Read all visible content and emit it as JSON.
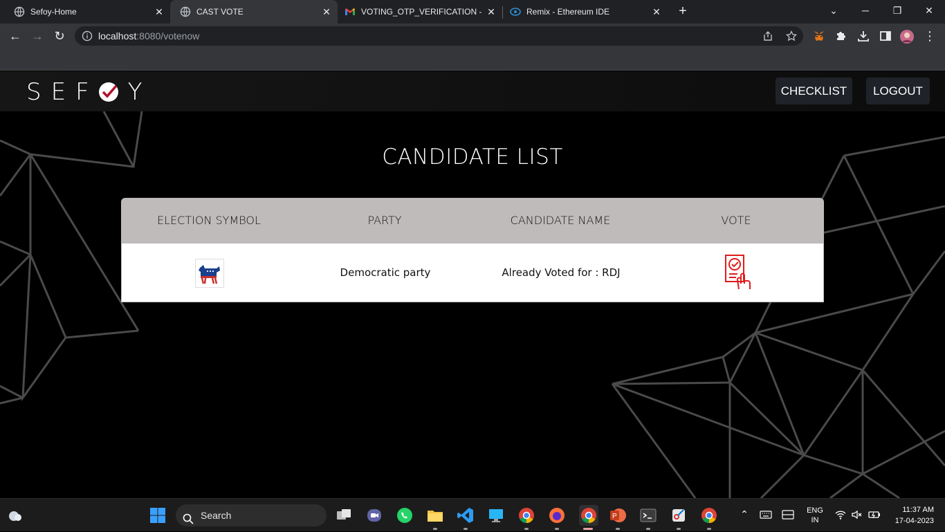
{
  "browser": {
    "tabs": [
      {
        "title": "Sefoy-Home",
        "icon": "globe-icon",
        "active": false
      },
      {
        "title": "CAST VOTE",
        "icon": "globe-icon",
        "active": true
      },
      {
        "title": "VOTING_OTP_VERIFICATION - shu",
        "icon": "gmail-icon",
        "active": false
      },
      {
        "title": "Remix - Ethereum IDE",
        "icon": "remix-icon",
        "active": false
      }
    ],
    "url_host": "localhost",
    "url_rest": ":8080/votenow"
  },
  "site": {
    "logo_text_left": "SEF",
    "logo_text_right": "Y",
    "nav": {
      "checklist_label": "CHECKLIST",
      "logout_label": "LOGOUT"
    }
  },
  "main": {
    "title": "CANDIDATE LIST",
    "table": {
      "headers": [
        "ELECTION SYMBOL",
        "PARTY",
        "CANDIDATE NAME",
        "VOTE"
      ],
      "rows": [
        {
          "symbol": "democratic-donkey-icon",
          "party": "Democratic party",
          "candidate": "Already Voted for : RDJ",
          "vote_icon": "vote-ballot-icon"
        }
      ]
    }
  },
  "taskbar": {
    "search_placeholder": "Search",
    "lang_line1": "ENG",
    "lang_line2": "IN",
    "time": "11:37 AM",
    "date": "17-04-2023"
  },
  "colors": {
    "accent_red": "#e01b1b",
    "header_gray": "#bfbbbb"
  }
}
